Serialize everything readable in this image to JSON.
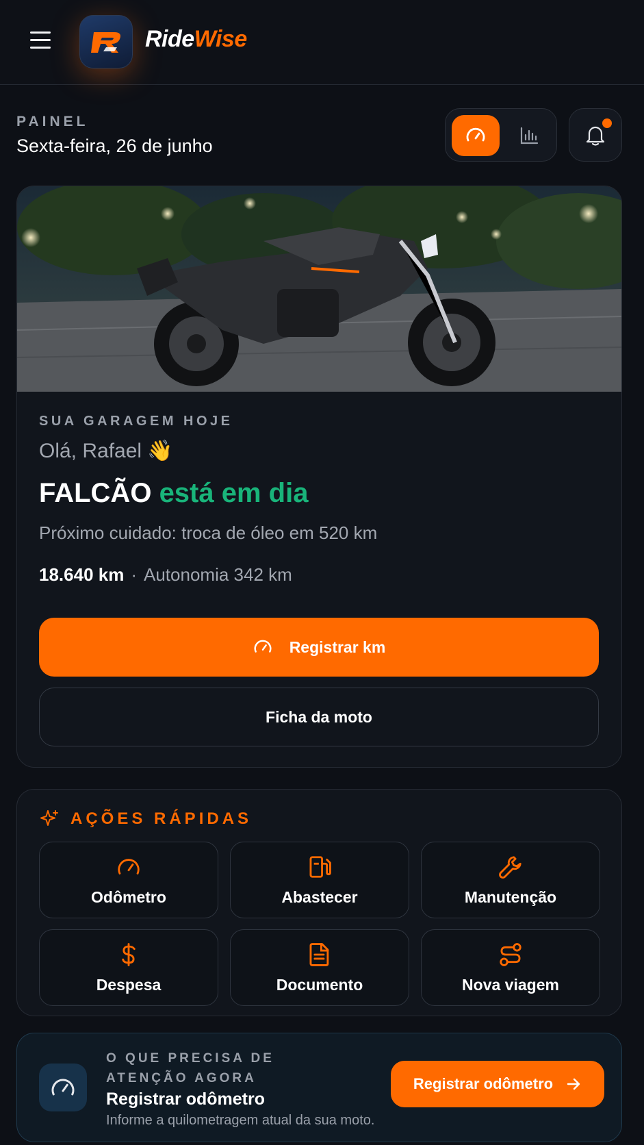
{
  "app": {
    "brand_part1": "Ride",
    "brand_part2": "Wise",
    "logo_letter": "R"
  },
  "header": {
    "eyebrow": "PAINEL",
    "date": "Sexta-feira, 26 de junho"
  },
  "hero": {
    "eyebrow": "SUA GARAGEM HOJE",
    "greeting": "Olá, Rafael 👋",
    "bike_name": "FALCÃO",
    "status": "está em dia",
    "next_care": "Próximo cuidado: troca de óleo em 520 km",
    "odometer": "18.640 km",
    "separator": "·",
    "autonomy": "Autonomia 342 km",
    "primary_button": "Registrar km",
    "secondary_button": "Ficha da moto"
  },
  "quick_actions": {
    "title": "AÇÕES RÁPIDAS",
    "items": [
      {
        "label": "Odômetro",
        "icon": "gauge-icon"
      },
      {
        "label": "Abastecer",
        "icon": "fuel-icon"
      },
      {
        "label": "Manutenção",
        "icon": "wrench-icon"
      },
      {
        "label": "Despesa",
        "icon": "dollar-icon"
      },
      {
        "label": "Documento",
        "icon": "document-icon"
      },
      {
        "label": "Nova viagem",
        "icon": "route-icon"
      }
    ]
  },
  "attention": {
    "eyebrow": "O QUE PRECISA DE ATENÇÃO AGORA",
    "title": "Registrar odômetro",
    "description": "Informe a quilometragem atual da sua moto.",
    "button": "Registrar odômetro"
  },
  "colors": {
    "accent": "#ff6a00",
    "ok": "#19b47a",
    "background": "#0d1016",
    "card": "#11151c"
  }
}
